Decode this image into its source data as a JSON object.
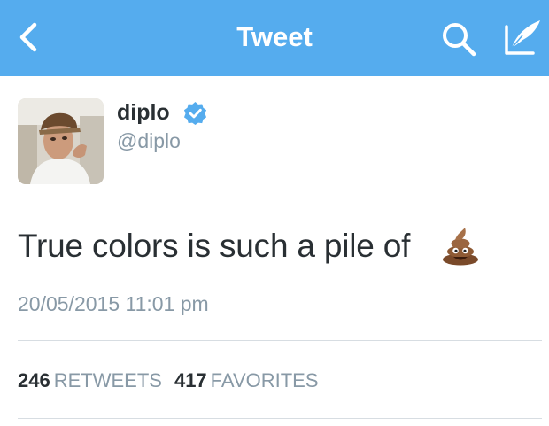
{
  "navbar": {
    "title": "Tweet",
    "background": "#55acee",
    "icons": {
      "back": "chevron-left-icon",
      "search": "search-icon",
      "compose": "compose-icon"
    }
  },
  "tweet": {
    "user": {
      "name": "diplo",
      "handle": "@diplo",
      "verified_icon": "verified-badge-icon"
    },
    "text": "True colors is such a pile of",
    "emoji_icon": "pile-of-poo-icon",
    "timestamp": "20/05/2015 11:01 pm"
  },
  "stats": {
    "retweets": {
      "count": "246",
      "label": "RETWEETS"
    },
    "favorites": {
      "count": "417",
      "label": "FAVORITES"
    }
  }
}
